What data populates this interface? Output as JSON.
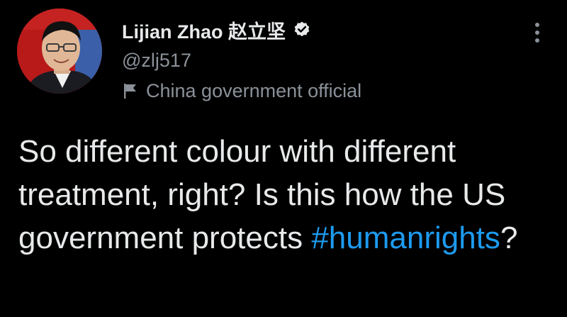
{
  "user": {
    "display_name": "Lijian Zhao 赵立坚",
    "handle": "@zlj517",
    "label": "China government official"
  },
  "tweet": {
    "text_before": "So different colour with different treatment, right? Is this how the US government protects ",
    "hashtag": "#humanrights",
    "text_after": "?"
  },
  "icons": {
    "verified": "verified-badge-icon",
    "flag": "flag-icon",
    "more": "more-vertical-icon"
  },
  "colors": {
    "background": "#000000",
    "primary_text": "#e7e9ea",
    "secondary_text": "#8b9199",
    "link": "#1d9bf0"
  }
}
